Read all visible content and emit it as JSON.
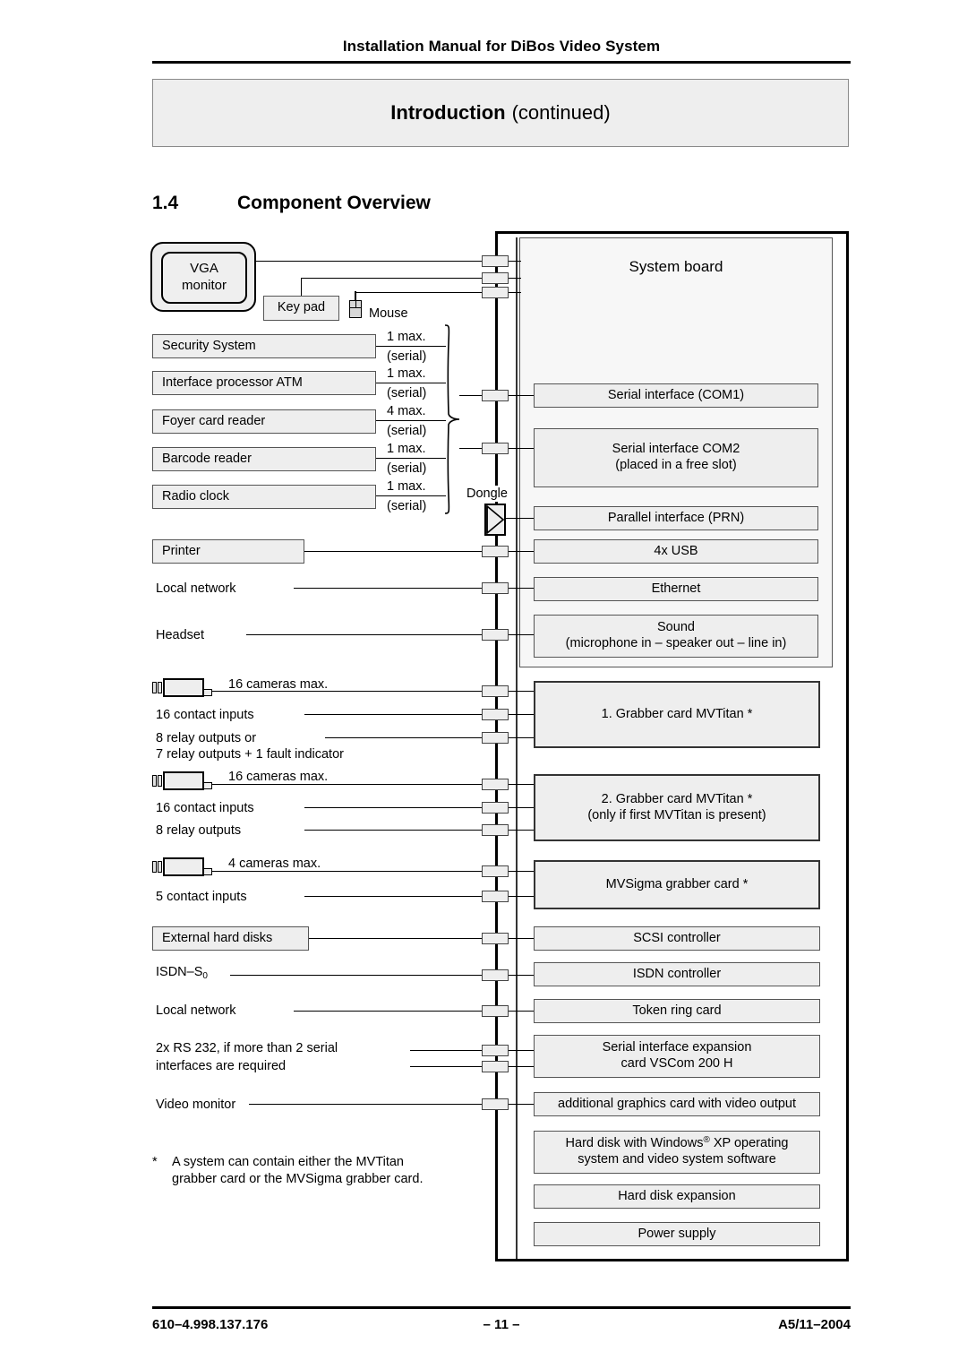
{
  "header": {
    "doc_title": "Installation Manual for DiBos Video System",
    "section_title": "Introduction",
    "section_suffix": "(continued)",
    "chapter_number": "1.4",
    "chapter_title": "Component Overview"
  },
  "footer": {
    "left": "610–4.998.137.176",
    "center": "– 11 –",
    "right": "A5/11–2004"
  },
  "diagram": {
    "system_board_title": "System board",
    "dongle_label": "Dongle",
    "monitor": {
      "line1": "VGA",
      "line2": "monitor"
    },
    "keypad_label": "Key pad",
    "mouse_label": "Mouse",
    "serial_devices": [
      {
        "name": "Security System",
        "max": "1 max.",
        "type": "(serial)"
      },
      {
        "name": "Interface processor ATM",
        "max": "1 max.",
        "type": "(serial)"
      },
      {
        "name": "Foyer card reader",
        "max": "4 max.",
        "type": "(serial)"
      },
      {
        "name": "Barcode reader",
        "max": "1 max.",
        "type": "(serial)"
      },
      {
        "name": "Radio clock",
        "max": "1 max.",
        "type": "(serial)"
      }
    ],
    "left_boxes": [
      {
        "label": "Printer"
      },
      {
        "label": "External hard disks"
      }
    ],
    "left_labels": [
      {
        "label": "Local network"
      },
      {
        "label": "Headset"
      },
      {
        "label": "16 cameras max."
      },
      {
        "label": "16 contact inputs"
      },
      {
        "label": "8 relay outputs or"
      },
      {
        "label": "7 relay outputs + 1 fault indicator"
      },
      {
        "label": "16 cameras max."
      },
      {
        "label": "16 contact inputs"
      },
      {
        "label": "8 relay outputs"
      },
      {
        "label": "4 cameras max."
      },
      {
        "label": "5 contact inputs"
      },
      {
        "label": "ISDN–S"
      },
      {
        "label": "Local network"
      },
      {
        "label": "2x RS 232, if more than 2 serial"
      },
      {
        "label": "interfaces are required"
      },
      {
        "label": "Video monitor"
      }
    ],
    "isdn_subscript": "0",
    "board_ports": [
      {
        "label": "Serial interface (COM1)"
      },
      {
        "label": "Serial interface COM2",
        "label2": "(placed in a free slot)"
      },
      {
        "label": "Parallel interface (PRN)"
      },
      {
        "label": "4x USB"
      },
      {
        "label": "Ethernet"
      },
      {
        "label": "Sound",
        "label2": "(microphone in – speaker out – line in)"
      }
    ],
    "cards": [
      {
        "label": "1. Grabber card MVTitan *"
      },
      {
        "label": "2. Grabber card MVTitan *",
        "label2": "(only if first MVTitan is present)"
      },
      {
        "label": "MVSigma grabber card *"
      },
      {
        "label": "SCSI controller"
      },
      {
        "label": "ISDN controller"
      },
      {
        "label": "Token ring card"
      },
      {
        "label": "Serial interface expansion",
        "label2": "card VSCom 200 H"
      },
      {
        "label": "additional graphics card with video output"
      },
      {
        "label": "Hard disk with Windows",
        "label_sup": "®",
        "label_tail": " XP operating",
        "label2": "system and video system software"
      },
      {
        "label": "Hard disk expansion"
      },
      {
        "label": "Power supply"
      }
    ],
    "footnote": {
      "marker": "*",
      "line1": "A system can contain either the MVTitan",
      "line2": "grabber card or the MVSigma grabber card."
    }
  }
}
